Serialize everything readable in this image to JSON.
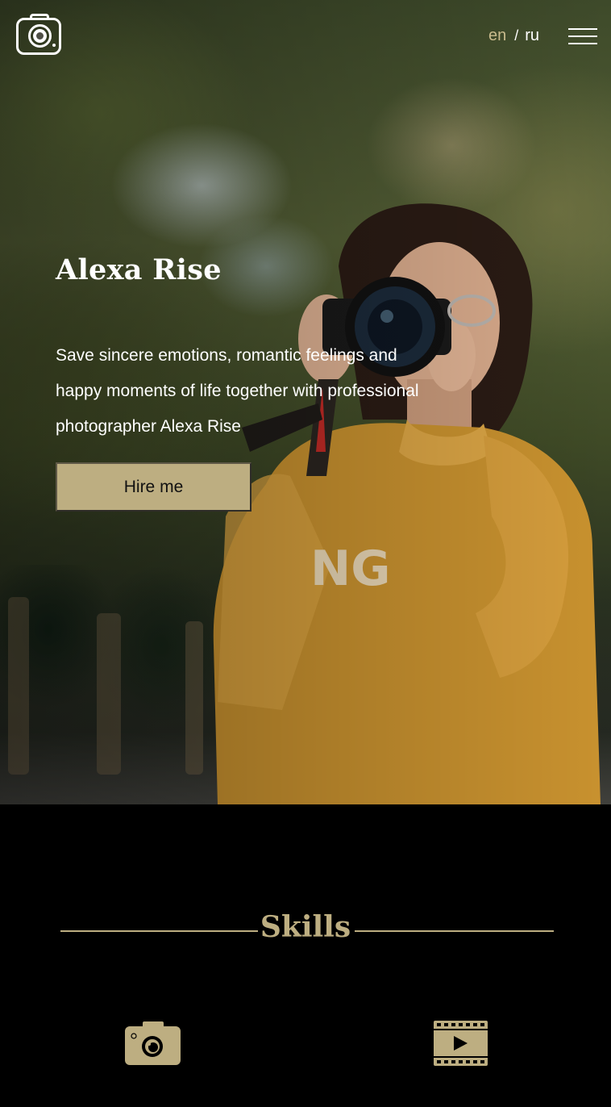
{
  "header": {
    "logo_icon": "camera-icon",
    "lang_en": "en",
    "lang_separator": "/",
    "lang_ru": "ru",
    "menu_icon": "hamburger-menu-icon"
  },
  "hero": {
    "title": "Alexa Rise",
    "line1": "Save sincere emotions, romantic feelings and",
    "line2": "happy moments of life together with professional",
    "line3": "photographer Alexa Rise",
    "cta_label": "Hire me"
  },
  "skills": {
    "title": "Skills",
    "items": [
      {
        "icon": "camera-icon"
      },
      {
        "icon": "video-film-icon"
      }
    ]
  },
  "colors": {
    "accent": "#bdae81",
    "background": "#000000",
    "text": "#ffffff"
  }
}
